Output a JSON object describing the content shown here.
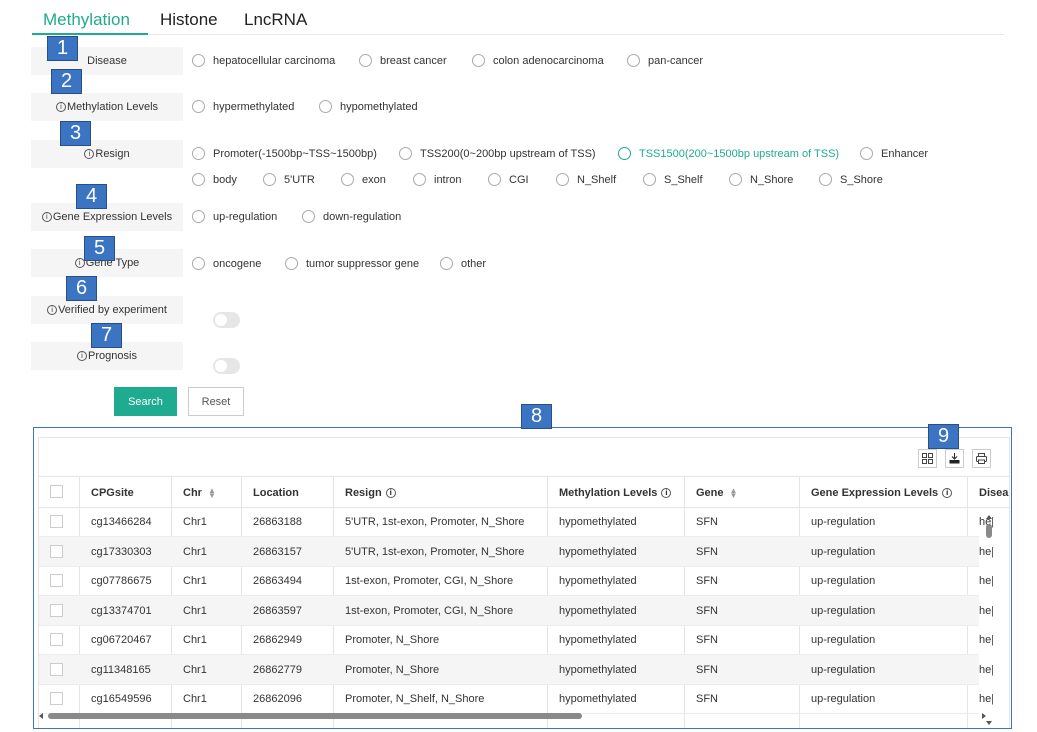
{
  "tabs": [
    "Methylation",
    "Histone",
    "LncRNA"
  ],
  "callouts": [
    "1",
    "2",
    "3",
    "4",
    "5",
    "6",
    "7",
    "8",
    "9"
  ],
  "form": {
    "disease": {
      "label": "Disease",
      "options": [
        "hepatocellular carcinoma",
        "breast cancer",
        "colon adenocarcinoma",
        "pan-cancer"
      ]
    },
    "methylation": {
      "label": "Methylation Levels",
      "options": [
        "hypermethylated",
        "hypomethylated"
      ]
    },
    "resign": {
      "label": "Resign",
      "options": [
        "Promoter(-1500bp~TSS~1500bp)",
        "TSS200(0~200bp upstream of TSS)",
        "TSS1500(200~1500bp upstream of TSS)",
        "Enhancer",
        "body",
        "5'UTR",
        "exon",
        "intron",
        "CGI",
        "N_Shelf",
        "S_Shelf",
        "N_Shore",
        "S_Shore"
      ],
      "selected": "TSS1500(200~1500bp upstream of TSS)"
    },
    "expression": {
      "label": "Gene Expression Levels",
      "options": [
        "up-regulation",
        "down-regulation"
      ]
    },
    "gene_type": {
      "label": "Gene Type",
      "options": [
        "oncogene",
        "tumor suppressor gene",
        "other"
      ]
    },
    "verified": {
      "label": "Verified by experiment",
      "value": false
    },
    "prognosis": {
      "label": "Prognosis",
      "value": false
    },
    "search_label": "Search",
    "reset_label": "Reset"
  },
  "info_glyph": "i",
  "table": {
    "headers": [
      "CPGsite",
      "Chr",
      "Location",
      "Resign",
      "Methylation Levels",
      "Gene",
      "Gene Expression Levels",
      "Disea"
    ],
    "rows": [
      [
        "cg13466284",
        "Chr1",
        "26863188",
        "5'UTR, 1st-exon, Promoter, N_Shore",
        "hypomethylated",
        "SFN",
        "up-regulation",
        "he|"
      ],
      [
        "cg17330303",
        "Chr1",
        "26863157",
        "5'UTR, 1st-exon, Promoter, N_Shore",
        "hypomethylated",
        "SFN",
        "up-regulation",
        "he|"
      ],
      [
        "cg07786675",
        "Chr1",
        "26863494",
        "1st-exon, Promoter, CGI, N_Shore",
        "hypomethylated",
        "SFN",
        "up-regulation",
        "he|"
      ],
      [
        "cg13374701",
        "Chr1",
        "26863597",
        "1st-exon, Promoter, CGI, N_Shore",
        "hypomethylated",
        "SFN",
        "up-regulation",
        "he|"
      ],
      [
        "cg06720467",
        "Chr1",
        "26862949",
        "Promoter, N_Shore",
        "hypomethylated",
        "SFN",
        "up-regulation",
        "he|"
      ],
      [
        "cg11348165",
        "Chr1",
        "26862779",
        "Promoter, N_Shore",
        "hypomethylated",
        "SFN",
        "up-regulation",
        "he|"
      ],
      [
        "cg16549596",
        "Chr1",
        "26862096",
        "Promoter, N_Shelf, N_Shore",
        "hypomethylated",
        "SFN",
        "up-regulation",
        "he|"
      ]
    ]
  },
  "colors": {
    "accent": "#1fab8f",
    "callout": "#3c74c4"
  },
  "icons": [
    "info-icon",
    "columns-icon",
    "export-icon",
    "print-icon",
    "sort-icon",
    "scroll-up-icon",
    "scroll-down-icon",
    "scroll-left-icon",
    "scroll-right-icon"
  ]
}
